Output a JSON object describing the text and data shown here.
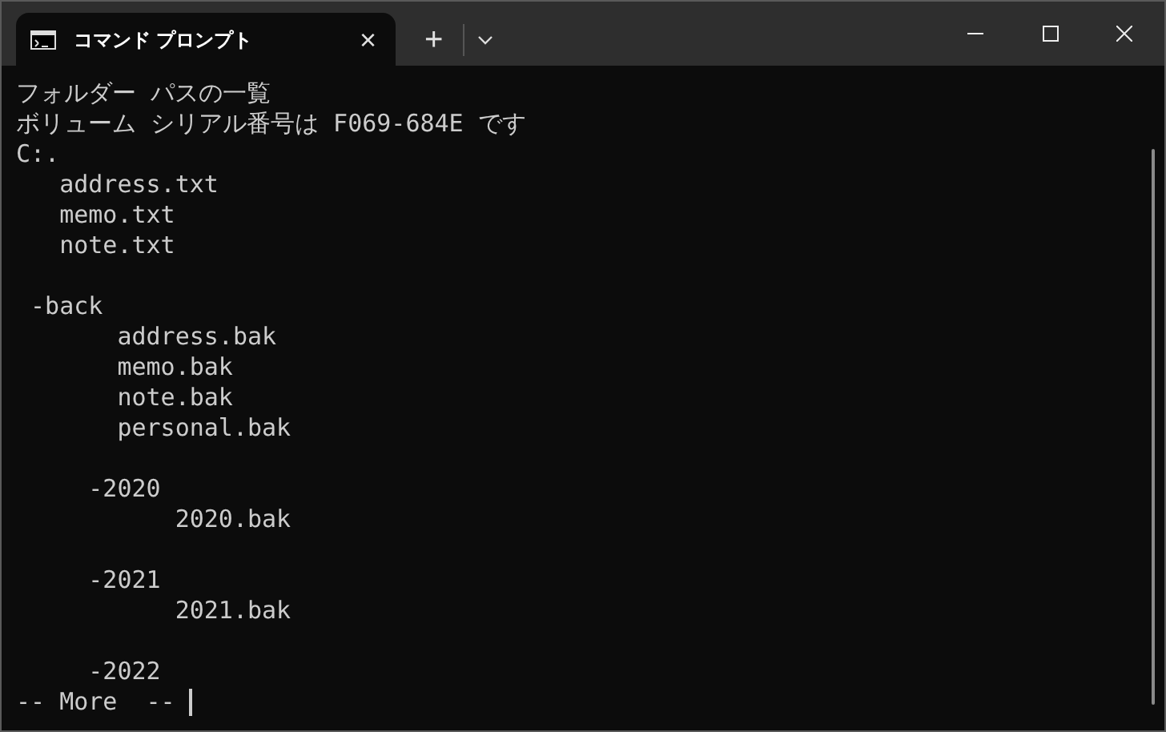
{
  "tab": {
    "title": "コマンド プロンプト",
    "close": "×",
    "selected": true
  },
  "new_tab": "+",
  "console": {
    "blocks": [
      [
        "フォルダー パスの一覧",
        "ボリューム シリアル番号は F069-684E です",
        "C:.",
        "   address.txt",
        "   memo.txt",
        "   note.txt"
      ],
      [
        " -back",
        "       address.bak",
        "       memo.bak",
        "       note.bak",
        "       personal.bak"
      ],
      [
        "     -2020",
        "           2020.bak"
      ],
      [
        "     -2021",
        "           2021.bak"
      ],
      [
        "     -2022",
        "-- More  -- "
      ]
    ]
  }
}
